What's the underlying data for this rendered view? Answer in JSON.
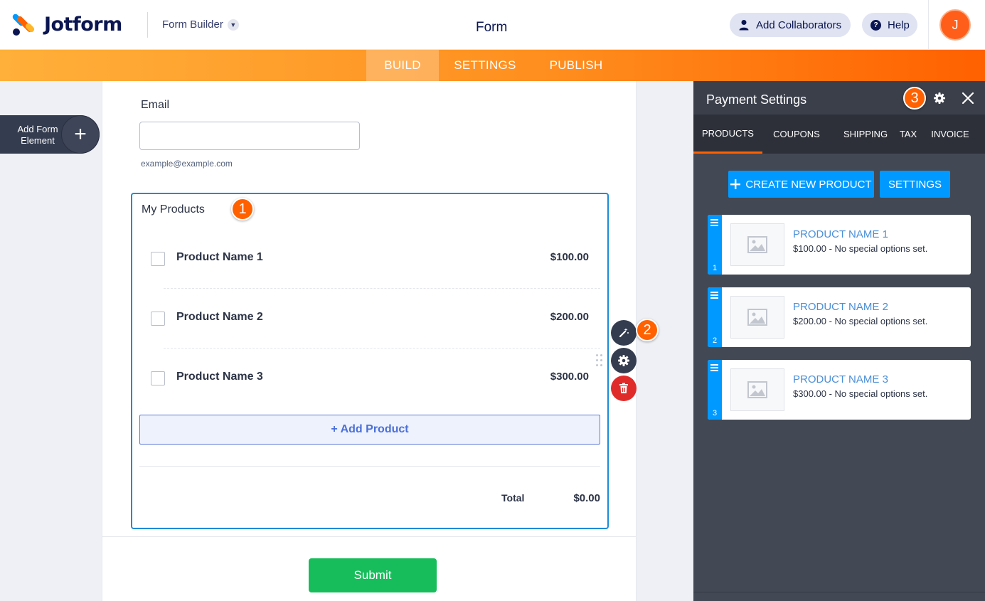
{
  "app": {
    "logo_text": "Jotform",
    "builder_menu": "Form Builder",
    "page_title": "Form",
    "add_collaborators": "Add Collaborators",
    "help": "Help",
    "avatar_initial": "J"
  },
  "nav": {
    "tabs": [
      {
        "label": "BUILD",
        "active": true
      },
      {
        "label": "SETTINGS",
        "active": false
      },
      {
        "label": "PUBLISH",
        "active": false
      }
    ]
  },
  "left_panel": {
    "add_element_label": "Add Form Element",
    "add_icon": "+"
  },
  "form": {
    "email": {
      "label": "Email",
      "value": "",
      "sublabel": "example@example.com"
    },
    "products_widget": {
      "title": "My Products",
      "products": [
        {
          "name": "Product Name 1",
          "price": "$100.00",
          "checked": false
        },
        {
          "name": "Product Name 2",
          "price": "$200.00",
          "checked": false
        },
        {
          "name": "Product Name 3",
          "price": "$300.00",
          "checked": false
        }
      ],
      "add_product_label": "+ Add Product",
      "total_label": "Total",
      "total_value": "$0.00"
    },
    "submit_label": "Submit"
  },
  "callouts": [
    "1",
    "2",
    "3"
  ],
  "payment_panel": {
    "title": "Payment Settings",
    "tabs": [
      {
        "label": "PRODUCTS",
        "active": true
      },
      {
        "label": "COUPONS",
        "active": false
      },
      {
        "label": "SHIPPING",
        "active": false
      },
      {
        "label": "TAX",
        "active": false
      },
      {
        "label": "INVOICE",
        "active": false
      }
    ],
    "create_button": "CREATE NEW PRODUCT",
    "settings_button": "SETTINGS",
    "products": [
      {
        "index": "1",
        "name": "PRODUCT NAME 1",
        "description": "$100.00 - No special options set."
      },
      {
        "index": "2",
        "name": "PRODUCT NAME 2",
        "description": "$200.00 - No special options set."
      },
      {
        "index": "3",
        "name": "PRODUCT NAME 3",
        "description": "$300.00 - No special options set."
      }
    ]
  },
  "colors": {
    "brand_orange": "#ff6100",
    "accent_blue": "#0099ff",
    "submit_green": "#18bd5b",
    "delete_red": "#e02b2b",
    "panel_dark": "#424854"
  },
  "icons": [
    "user-icon",
    "help-icon",
    "plus-icon",
    "magic-wand-icon",
    "gear-icon",
    "trash-icon",
    "close-icon",
    "image-placeholder-icon",
    "drag-handle-icon"
  ]
}
